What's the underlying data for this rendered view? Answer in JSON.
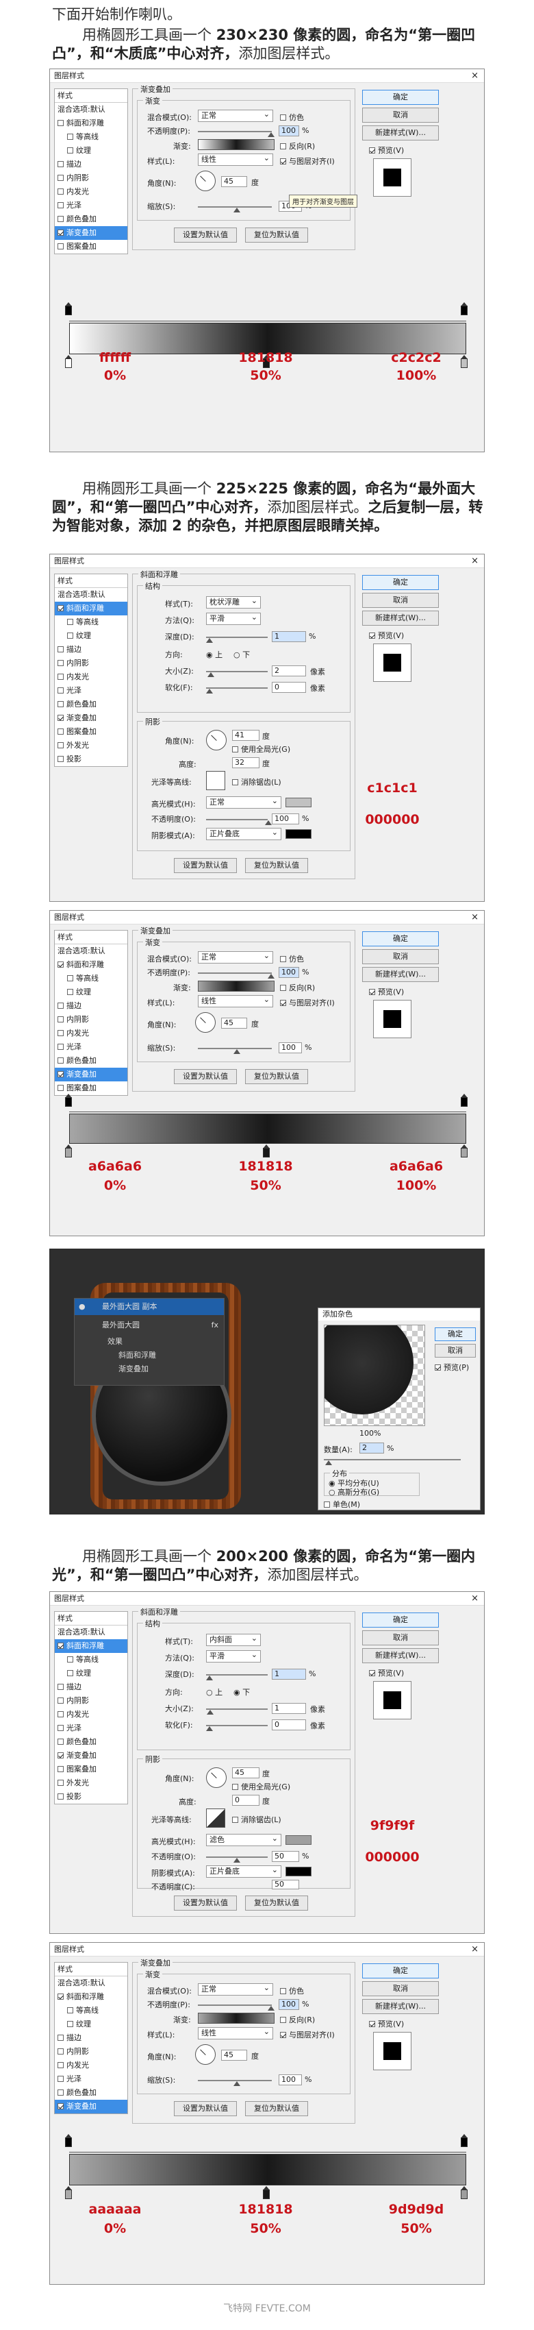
{
  "intro": {
    "line1": "下面开始制作喇叭。"
  },
  "p1": {
    "pre": "用椭圆形工具画一个 ",
    "bold1": "230×230 像素的圆，命名为“第一圈凹凸”，和“木质底”中心对齐，",
    "post": "添加图层样式。"
  },
  "p2": {
    "pre": "用椭圆形工具画一个 ",
    "bold1": "225×225 像素的圆，命名为“最外面大圆”，和“第一圈凹凸”中心对齐，",
    "mid": "添加图层样式。",
    "bold2": "之后复制一层，转为智能对象，添加 2 的杂色，并把原图层眼睛关掉。"
  },
  "p3": {
    "pre": "用椭圆形工具画一个 ",
    "bold1": "200×200 像素的圆，命名为“第一圈内光”，和“第一圈凹凸”中心对齐，",
    "post": "添加图层样式。"
  },
  "dialog": {
    "title": "图层样式",
    "close": "×",
    "styles_header": "样式",
    "blend_default": "混合选项:默认",
    "items": [
      "斜面和浮雕",
      "等高线",
      "纹理",
      "描边",
      "内阴影",
      "内发光",
      "光泽",
      "颜色叠加",
      "渐变叠加",
      "图案叠加",
      "外发光",
      "投影"
    ],
    "btn_ok": "确定",
    "btn_cancel": "取消",
    "btn_new": "新建样式(W)...",
    "preview_label": "预览(V)",
    "set_default": "设置为默认值",
    "reset_default": "复位为默认值"
  },
  "gradient": {
    "section": "渐变叠加",
    "sub": "渐变",
    "blend_mode_label": "混合模式(O):",
    "blend_mode": "正常",
    "dither": "仿色",
    "opacity_label": "不透明度(P):",
    "opacity": "100",
    "pct": "%",
    "gradient_label": "渐变:",
    "reverse": "反向(R)",
    "style_label": "样式(L):",
    "style": "线性",
    "align": "与图层对齐(I)",
    "angle_label": "角度(N):",
    "angle": "45",
    "deg": "度",
    "scale_label": "缩放(S):",
    "scale": "100",
    "tooltip": "用于对齐渐变与图层"
  },
  "bevel": {
    "section": "斜面和浮雕",
    "sub": "结构",
    "style_label": "样式(T):",
    "style_outer": "枕状浮雕",
    "style_inner": "内斜面",
    "method_label": "方法(Q):",
    "method": "平滑",
    "depth_label": "深度(D):",
    "depth": "1",
    "pct": "%",
    "dir_label": "方向:",
    "dir_up": "上",
    "dir_down": "下",
    "size_label": "大小(Z):",
    "size_outer": "2",
    "size_inner": "1",
    "px": "像素",
    "soften_label": "软化(F):",
    "soften": "0",
    "shading": "阴影",
    "angle_label": "角度(N):",
    "angle_outer": "41",
    "angle_inner": "45",
    "deg": "度",
    "global_light": "使用全局光(G)",
    "alt_label": "高度:",
    "alt_outer": "32",
    "alt_inner": "0",
    "gloss_label": "光泽等高线:",
    "anti_alias": "消除锯齿(L)",
    "hl_label": "高光模式(H):",
    "hl_mode_outer": "正常",
    "hl_mode_inner": "滤色",
    "op_label": "不透明度(O):",
    "hl_op": "100",
    "sh_label": "阴影模式(A):",
    "sh_mode": "正片叠底",
    "sh_op_label": "不透明度(C):",
    "sh_op": "100",
    "hl_op_inner": "50",
    "sh_op_inner": "50"
  },
  "labels1": {
    "c1": "ffffff",
    "c2": "181818",
    "c3": "c2c2c2",
    "p1": "0%",
    "p2": "50%",
    "p3": "100%"
  },
  "labels2": {
    "c1": "c1c1c1",
    "c2": "000000"
  },
  "labels3": {
    "c1": "a6a6a6",
    "c2": "181818",
    "c3": "a6a6a6",
    "p1": "0%",
    "p2": "50%",
    "p3": "100%"
  },
  "labels4": {
    "c1": "9f9f9f",
    "c2": "000000"
  },
  "labels5": {
    "c1": "aaaaaa",
    "c2": "181818",
    "c3": "9d9d9d",
    "p1": "0%",
    "p2": "50%",
    "p3": "50%"
  },
  "ps": {
    "layer1": "最外面大圆 副本",
    "layer2": "最外面大圆",
    "fx": "fx",
    "effects": "效果",
    "eff1": "斜面和浮雕",
    "eff2": "渐变叠加",
    "noise_title": "添加杂色",
    "ok": "确定",
    "cancel": "取消",
    "preview": "预览(P)",
    "zoom": "100%",
    "amount_label": "数量(A):",
    "amount": "2",
    "pct": "%",
    "dist": "分布",
    "uniform": "平均分布(U)",
    "gauss": "高斯分布(G)",
    "mono": "单色(M)"
  },
  "footer": "飞特网 FEVTE.COM",
  "colors": {
    "red": "#c8141b",
    "accent": "#3d8ee6"
  }
}
